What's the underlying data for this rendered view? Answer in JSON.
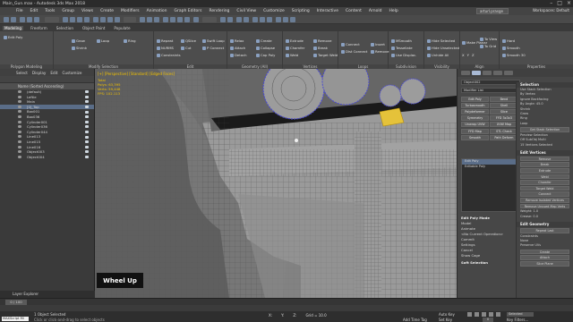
{
  "window": {
    "title": "Main_Gun.max - Autodesk 3ds Max 2018"
  },
  "menubar": {
    "items": [
      "File",
      "Edit",
      "Tools",
      "Group",
      "Views",
      "Create",
      "Modifiers",
      "Animation",
      "Graph Editors",
      "Rendering",
      "Civil View",
      "Customize",
      "Scripting",
      "Interactive",
      "Content",
      "Arnold",
      "Help"
    ],
    "sign_in": "arturl.prasge",
    "workspace_label": "Workspaces: Default"
  },
  "ribbon": {
    "tabs": [
      "Modeling",
      "Freeform",
      "Selection",
      "Object Paint",
      "Populate"
    ],
    "active_tab": "Modeling",
    "groups": [
      {
        "title": "Polygon Modeling",
        "buttons": [
          "Edit Poly"
        ]
      },
      {
        "title": "Modify Selection",
        "buttons": [
          "Grow",
          "Shrink",
          "Loop",
          "Ring"
        ]
      },
      {
        "title": "Edit",
        "buttons": [
          "Repeat",
          "QSlice",
          "Swift Loop",
          "NURMS",
          "Cut",
          "P Connect",
          "Constraints"
        ]
      },
      {
        "title": "Geometry (All)",
        "buttons": [
          "Relax",
          "Create",
          "Attach",
          "Detach",
          "Collapse",
          "Cap Poly"
        ]
      },
      {
        "title": "Vertices",
        "buttons": [
          "Extrude",
          "Chamfer",
          "Weld",
          "Remove",
          "Break",
          "Target Weld"
        ]
      },
      {
        "title": "Loops",
        "buttons": [
          "Connect",
          "Dist Connect",
          "Insert",
          "Remove"
        ]
      },
      {
        "title": "Subdivision",
        "buttons": [
          "MSmooth",
          "Tessellate",
          "Use Displac."
        ]
      },
      {
        "title": "Visibility",
        "buttons": [
          "Hide Selected",
          "Hide Unselected",
          "Unhide All"
        ]
      },
      {
        "title": "Align",
        "buttons": [
          "Make Planar",
          "To View",
          "To Grid",
          "X",
          "Y",
          "Z"
        ]
      },
      {
        "title": "Properties",
        "buttons": [
          "Hard",
          "Smooth",
          "Smooth 30"
        ]
      }
    ]
  },
  "explorer": {
    "tabs": [
      "Select",
      "Display",
      "Edit",
      "Customize"
    ],
    "header": "Name (Sorted Ascending)",
    "rows": [
      {
        "name": "(default)",
        "selected": false
      },
      {
        "name": "Leftie",
        "selected": false
      },
      {
        "name": "Main",
        "selected": false
      },
      {
        "name": "[0]_Top",
        "selected": true
      },
      {
        "name": "Box001",
        "selected": false
      },
      {
        "name": "Box036",
        "selected": false
      },
      {
        "name": "Cylinder001",
        "selected": false
      },
      {
        "name": "Cylinder036",
        "selected": false
      },
      {
        "name": "Cylinder044",
        "selected": false
      },
      {
        "name": "Line013",
        "selected": false
      },
      {
        "name": "Line015",
        "selected": false
      },
      {
        "name": "Line016",
        "selected": false
      },
      {
        "name": "Object003",
        "selected": false
      },
      {
        "name": "Object004",
        "selected": false
      }
    ],
    "layer_label": "Layer Explorer"
  },
  "viewport": {
    "label": "[+] [Perspective] [Standard] [Edged Faces]",
    "stats": [
      "Total",
      "Polys:  63,395",
      "Verts:  59,448",
      "",
      "FPS:  102.113"
    ],
    "badge": "Wheel Up"
  },
  "command_panel": {
    "object_name": "Object002",
    "modifier_list": "Modifier List",
    "modifier_buttons": [
      "Edit Poly",
      "Bend",
      "Turbosmooth",
      "Shell",
      "Polydeformer",
      "Slice",
      "Symmetry",
      "FFD 3x3x3",
      "Unwrap UVW",
      "UVW Map",
      "FFD Map",
      "STL Check",
      "Smooth",
      "Path Deform"
    ],
    "stack": [
      {
        "name": "Edit Poly",
        "selected": true
      },
      {
        "name": "Editable Poly",
        "selected": false
      }
    ],
    "sections": [
      {
        "title": "Edit Poly Mode",
        "lines": [
          "Model",
          "Animate",
          "<No Current Operation>",
          "Commit",
          "Settings",
          "Cancel",
          "Show Cage"
        ]
      },
      {
        "title": "Soft Selection",
        "lines": []
      }
    ]
  },
  "right_panel": {
    "selection_title": "Selection",
    "selection_lines": [
      "Use Stack Selection",
      "By Vertex",
      "Ignore Backfacing",
      "By Angle: 45.0",
      "Shrink",
      "Grow",
      "Ring",
      "Loop",
      "Get Stack Selection",
      "Preview Selection",
      "Off  SubObj  Multi",
      "15 Vertices Selected"
    ],
    "edit_vertices_title": "Edit Vertices",
    "edit_vertices_lines": [
      "Remove",
      "Break",
      "Extrude",
      "Weld",
      "Chamfer",
      "Target Weld",
      "Connect",
      "Remove Isolated Vertices",
      "Remove Unused Map Verts",
      "Weight: 1.0",
      "Crease: 0.0"
    ],
    "edit_geometry_title": "Edit Geometry",
    "edit_geometry_lines": [
      "Repeat Last",
      "Constraints",
      "None",
      "Edge",
      "Face",
      "Normal",
      "Preserve UVs",
      "Create",
      "Collapse",
      "Attach",
      "Detach",
      "Slice Plane",
      "Split"
    ]
  },
  "timeline": {
    "slider_label": "0 / 100"
  },
  "status": {
    "line1": "1 Object Selected",
    "line2": "Click or click-and-drag to select objects",
    "maxscript": "MAXScript Mi",
    "coords": [
      "X:",
      "Y:",
      "Z:",
      "Grid = 10.0"
    ],
    "add_time_tag": "Add Time Tag",
    "auto_key": "Auto Key",
    "set_key": "Set Key",
    "key_filters": "Key Filters...",
    "selected_dd": "Selected",
    "frame": "0"
  }
}
